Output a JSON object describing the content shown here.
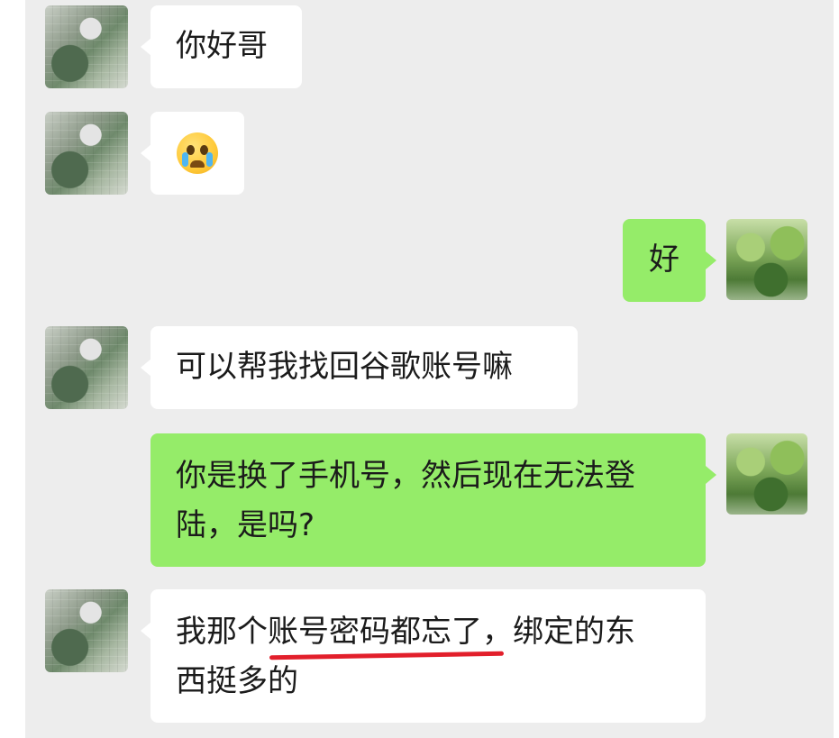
{
  "messages": [
    {
      "side": "left",
      "text": "你好哥"
    },
    {
      "side": "left",
      "emoji": "loudly-crying-face"
    },
    {
      "side": "right",
      "text": "好"
    },
    {
      "side": "left",
      "text": "可以帮我找回谷歌账号嘛"
    },
    {
      "side": "right",
      "lines": [
        "你是换了手机号，然后现在无法登",
        "陆，是吗?"
      ]
    },
    {
      "side": "left",
      "lines_parts": [
        [
          "我那个",
          "账号密码都忘了",
          "，绑定的东"
        ],
        [
          "西挺多的"
        ]
      ]
    }
  ],
  "colors": {
    "background": "#ededed",
    "left_bubble": "#ffffff",
    "right_bubble": "#95ec69",
    "underline": "#e21f2b"
  }
}
